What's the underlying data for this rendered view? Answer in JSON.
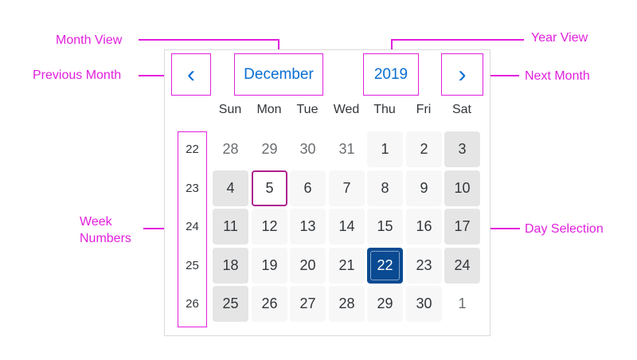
{
  "labels": {
    "month_view": "Month View",
    "year_view": "Year View",
    "previous_month": "Previous Month",
    "next_month": "Next Month",
    "week_numbers_line1": "Week",
    "week_numbers_line2": "Numbers",
    "day_selection": "Day Selection"
  },
  "header": {
    "prev_glyph": "‹",
    "next_glyph": "›",
    "month": "December",
    "year": "2019"
  },
  "weekdays": [
    "Sun",
    "Mon",
    "Tue",
    "Wed",
    "Thu",
    "Fri",
    "Sat"
  ],
  "week_numbers": [
    "22",
    "23",
    "24",
    "25",
    "26"
  ],
  "days": [
    [
      "28",
      "29",
      "30",
      "31",
      "1",
      "2",
      "3"
    ],
    [
      "4",
      "5",
      "6",
      "7",
      "8",
      "9",
      "10"
    ],
    [
      "11",
      "12",
      "13",
      "14",
      "15",
      "16",
      "17"
    ],
    [
      "18",
      "19",
      "20",
      "21",
      "22",
      "23",
      "24"
    ],
    [
      "25",
      "26",
      "27",
      "28",
      "29",
      "30",
      "1"
    ]
  ],
  "colors": {
    "annotation": "#e11fdc",
    "accent": "#0a6ed1",
    "selected": "#0a4a92",
    "today_border": "#ab218e"
  }
}
